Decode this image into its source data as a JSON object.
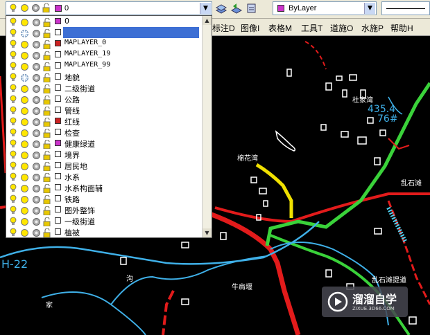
{
  "toolbar": {
    "layer_combo_value": "0",
    "color_combo_value": "ByLayer",
    "layer_color": "#cc33cc",
    "color_swatch": "#cc33cc"
  },
  "menu": {
    "items": [
      "标注D",
      "图像I",
      "表格M",
      "工具T",
      "道施O",
      "水施P",
      "帮助H"
    ]
  },
  "layers": [
    {
      "name": "0",
      "color": "#cc33cc",
      "frozen": false,
      "mono": false
    },
    {
      "name": "",
      "color": "#ffffff",
      "frozen": true,
      "selected": true,
      "mono": false
    },
    {
      "name": "MAPLAYER_0",
      "color": "#cc2222",
      "frozen": false,
      "mono": true
    },
    {
      "name": "MAPLAYER_19",
      "color": "#ffffff",
      "frozen": false,
      "mono": true
    },
    {
      "name": "MAPLAYER_99",
      "color": "#ffffff",
      "frozen": false,
      "mono": true
    },
    {
      "name": "地貌",
      "color": "#ffffff",
      "frozen": true,
      "mono": false
    },
    {
      "name": "二级街道",
      "color": "#ffffff",
      "frozen": false,
      "mono": false
    },
    {
      "name": "公路",
      "color": "#ffffff",
      "frozen": false,
      "mono": false
    },
    {
      "name": "管线",
      "color": "#ffffff",
      "frozen": false,
      "mono": false
    },
    {
      "name": "红线",
      "color": "#cc2222",
      "frozen": false,
      "mono": false
    },
    {
      "name": "检查",
      "color": "#ffffff",
      "frozen": false,
      "mono": false
    },
    {
      "name": "健康绿道",
      "color": "#cc33cc",
      "frozen": false,
      "mono": false
    },
    {
      "name": "境界",
      "color": "#ffffff",
      "frozen": false,
      "mono": false
    },
    {
      "name": "居民地",
      "color": "#ffffff",
      "frozen": false,
      "mono": false
    },
    {
      "name": "水系",
      "color": "#ffffff",
      "frozen": false,
      "mono": false
    },
    {
      "name": "水系构面辅",
      "color": "#ffffff",
      "frozen": false,
      "mono": false
    },
    {
      "name": "铁路",
      "color": "#ffffff",
      "frozen": false,
      "mono": false
    },
    {
      "name": "图外整饰",
      "color": "#ffffff",
      "frozen": false,
      "mono": false
    },
    {
      "name": "一级街道",
      "color": "#ffffff",
      "frozen": false,
      "mono": false
    },
    {
      "name": "植被",
      "color": "#ffffff",
      "frozen": false,
      "mono": false
    }
  ],
  "map_labels": {
    "village1": "杜家湾",
    "village2": "棉花湾",
    "village3": "乱石滩",
    "village4": "乱石滩提道",
    "place1": "牛肩堰",
    "elev_top": "435.4",
    "elev_sub": "76#",
    "code_left": "H-22",
    "char_gou": "沟",
    "char_jia": "家"
  },
  "watermark": {
    "title": "溜溜自学",
    "url": "ZIXUE.3D66.COM"
  }
}
